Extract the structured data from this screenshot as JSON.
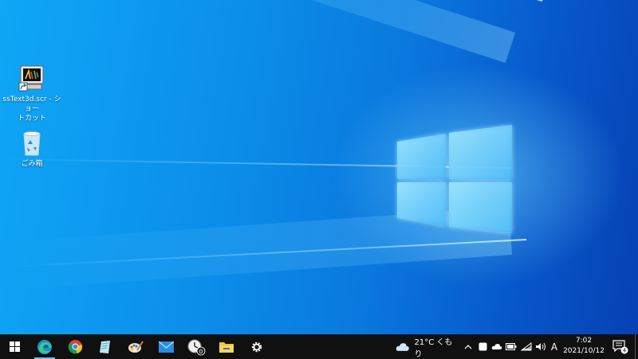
{
  "desktop": {
    "icons": [
      {
        "label_line1": "ssText3d.scr - ショー",
        "label_line2": "トカット",
        "icon": "screensaver-shortcut-icon"
      },
      {
        "label": "ごみ箱",
        "icon": "recycle-bin-icon"
      }
    ],
    "colors": {
      "accent": "#0a7fe0",
      "logo_glow": "#7fe0ff"
    }
  },
  "taskbar": {
    "start_icon": "windows-start-icon",
    "pinned": [
      {
        "icon": "edge-icon",
        "active": true
      },
      {
        "icon": "chrome-icon",
        "active": false
      },
      {
        "icon": "notepad-icon",
        "active": false
      },
      {
        "icon": "paint-icon",
        "active": false
      },
      {
        "icon": "mail-icon",
        "active": false
      },
      {
        "icon": "clock-app-icon",
        "active": false,
        "badge": "0"
      },
      {
        "icon": "file-explorer-icon",
        "active": false
      },
      {
        "icon": "settings-gear-icon",
        "active": false
      }
    ],
    "weather": {
      "icon": "cloud-weather-icon",
      "text": "21°C くもり"
    },
    "tray": {
      "show_hidden_icon": "chevron-up-icon",
      "icons": [
        "tablet-icon",
        "onedrive-cloud-icon",
        "battery-icon",
        "wifi-icon",
        "volume-icon"
      ],
      "ime": "A"
    },
    "clock": {
      "time": "7:02",
      "date": "2021/10/12"
    },
    "notifications": {
      "icon": "notification-icon",
      "count": "4"
    }
  }
}
